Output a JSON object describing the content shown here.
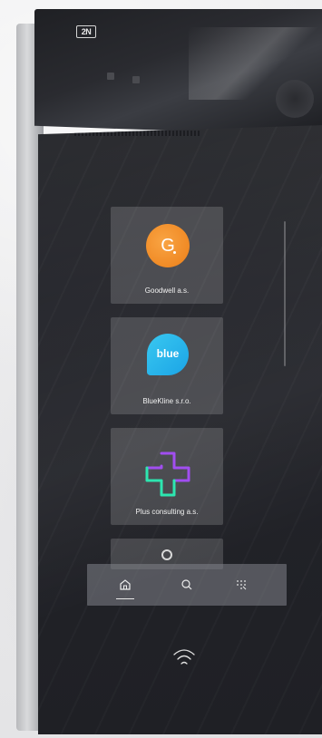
{
  "device": {
    "brand": "2N"
  },
  "directory": {
    "items": [
      {
        "name": "Goodwell a.s.",
        "logo_text": "G",
        "logo_color": "#f08a25"
      },
      {
        "name": "BlueKline s.r.o.",
        "logo_text": "blue",
        "logo_color": "#1ba4e6"
      },
      {
        "name": "Plus consulting a.s.",
        "logo_colors": [
          "#a14ef0",
          "#2de6b0"
        ]
      }
    ]
  },
  "navbar": {
    "items": [
      {
        "id": "home",
        "icon": "home-icon",
        "active": true
      },
      {
        "id": "search",
        "icon": "search-icon",
        "active": false
      },
      {
        "id": "keypad",
        "icon": "keypad-icon",
        "active": false
      }
    ]
  },
  "accent": {
    "panel": "#23242a",
    "tile": "rgba(255,255,255,0.16)",
    "text": "#f1f1f1"
  }
}
